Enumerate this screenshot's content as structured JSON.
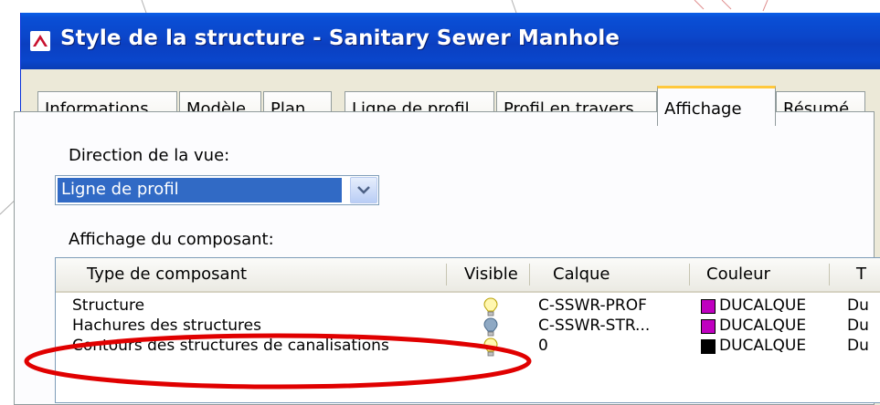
{
  "window": {
    "title": "Style de la structure - Sanitary Sewer Manhole"
  },
  "tabs": [
    {
      "label": "Informations",
      "active": false
    },
    {
      "label": "Modèle",
      "active": false
    },
    {
      "label": "Plan",
      "active": false
    },
    {
      "label": "Ligne de profil",
      "active": false
    },
    {
      "label": "Profil en travers",
      "active": false
    },
    {
      "label": "Affichage",
      "active": true
    },
    {
      "label": "Résumé",
      "active": false
    }
  ],
  "view_direction": {
    "label": "Direction de la vue:",
    "selected": "Ligne de profil"
  },
  "component_display": {
    "label": "Affichage du composant:",
    "columns": [
      "Type de composant",
      "Visible",
      "Calque",
      "Couleur",
      "T"
    ],
    "rows": [
      {
        "type": "Structure",
        "visible": "on",
        "layer": "C-SSWR-PROF",
        "color_name": "DUCALQUE",
        "color": "#c000c0",
        "t": "Du"
      },
      {
        "type": "Hachures des structures",
        "visible": "off",
        "layer": "C-SSWR-STR...",
        "color_name": "DUCALQUE",
        "color": "#c000c0",
        "t": "Du"
      },
      {
        "type": "Contours des structures de canalisations",
        "visible": "on",
        "layer": "0",
        "color_name": "DUCALQUE",
        "color": "#000000",
        "t": "Du"
      }
    ]
  },
  "colors": {
    "titlebar": "#0b45c9",
    "selection": "#316ac5",
    "highlight_ellipse": "#e00000",
    "active_tab_accent": "#ffc83c"
  }
}
